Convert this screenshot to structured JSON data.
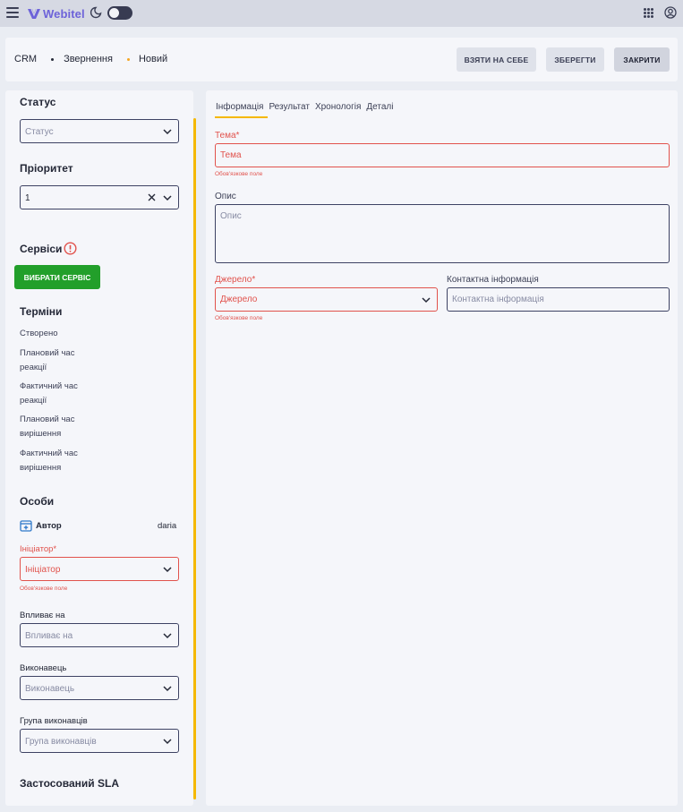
{
  "topbar": {
    "logo": "Webitel",
    "icons": [
      "menu-icon",
      "webitel-logo",
      "moon-icon",
      "theme-toggle",
      "apps-grid-icon",
      "account-icon"
    ]
  },
  "header": {
    "breadcrumbs": [
      "CRM",
      "Звернення",
      "Новий"
    ],
    "buttons": {
      "take": "ВЗЯТИ НА СЕБЕ",
      "save": "ЗБЕРЕГТИ",
      "close": "ЗАКРИТИ"
    }
  },
  "left": {
    "status": {
      "title": "Статус",
      "placeholder": "Статус"
    },
    "priority": {
      "title": "Пріоритет",
      "value": "1"
    },
    "services": {
      "title": "Сервіси",
      "button": "ВИБРАТИ СЕРВІС"
    },
    "terms": {
      "title": "Терміни",
      "items": [
        "Створено",
        "Плановий час реакції",
        "Фактичний час реакції",
        "Плановий час вирішення",
        "Фактичний час вирішення"
      ]
    },
    "persons": {
      "title": "Особи",
      "author_label": "Автор",
      "author_value": "daria",
      "initiator_label": "Ініціатор*",
      "initiator_placeholder": "Ініціатор",
      "required_hint": "Обов'язкове поле",
      "impacted_label": "Впливає на",
      "impacted_placeholder": "Впливає на",
      "assignee_label": "Виконавець",
      "assignee_placeholder": "Виконавець",
      "group_label": "Група виконавців",
      "group_placeholder": "Група виконавців"
    },
    "sla": {
      "title": "Застосований SLA"
    }
  },
  "right": {
    "tabs": [
      "Інформація",
      "Результат",
      "Хронологія",
      "Деталі"
    ],
    "active_tab": "Інформація",
    "subject": {
      "label": "Тема*",
      "placeholder": "Тема",
      "hint": "Обов'язкове поле"
    },
    "description": {
      "label": "Опис",
      "placeholder": "Опис"
    },
    "source": {
      "label": "Джерело*",
      "placeholder": "Джерело",
      "hint": "Обов'язкове поле"
    },
    "contact": {
      "label": "Контактна інформація",
      "placeholder": "Контактна інформація"
    }
  },
  "colors": {
    "accent": "#f5b800",
    "error": "#e1524c",
    "primary_button": "#229f2a",
    "brand": "#6d63d9"
  }
}
